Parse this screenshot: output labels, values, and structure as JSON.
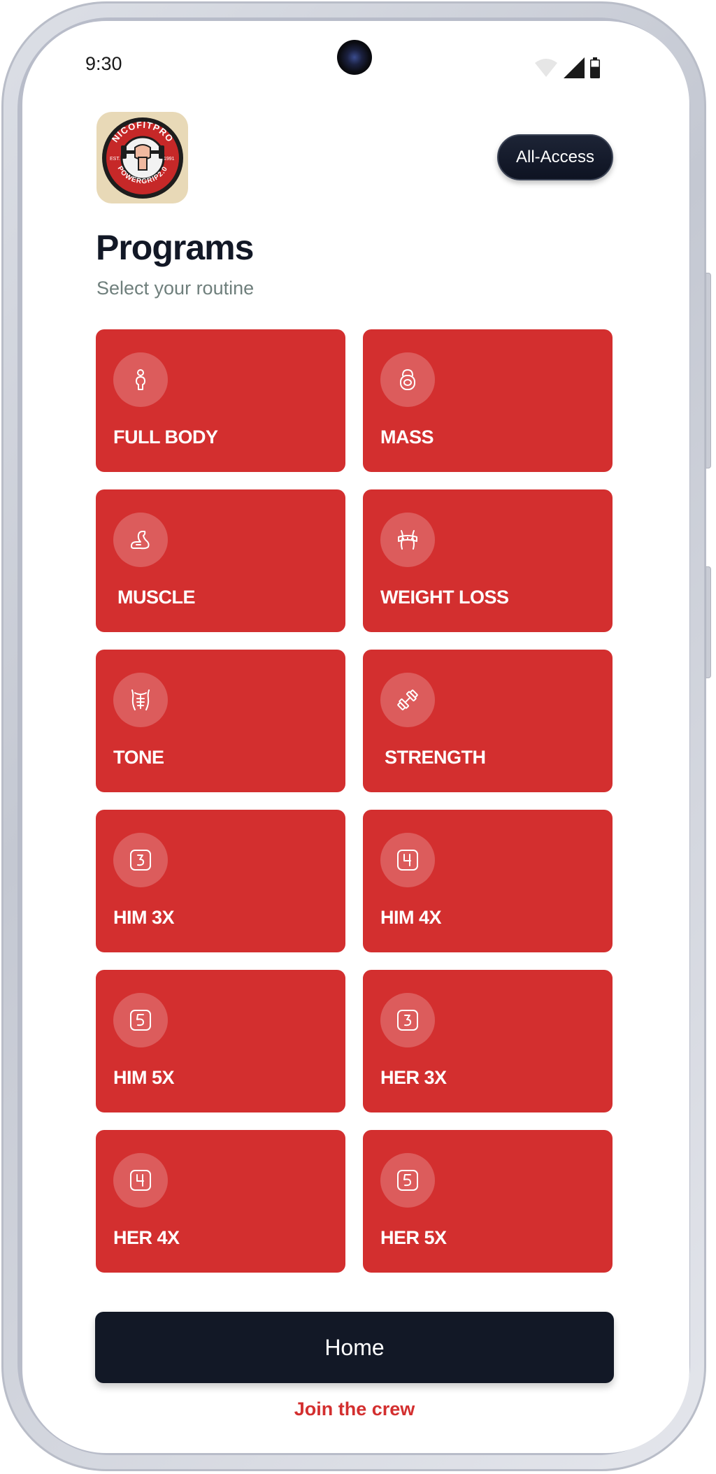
{
  "status_bar": {
    "time": "9:30"
  },
  "header": {
    "logo": {
      "text_top": "NICOFITPRO",
      "text_bottom": "POWERGRIP2.0",
      "est": "EST.",
      "year": "1991"
    },
    "all_access_label": "All-Access"
  },
  "page": {
    "title": "Programs",
    "subtitle": "Select your routine"
  },
  "programs": [
    {
      "label": "FULL BODY",
      "icon": "person-icon"
    },
    {
      "label": "MASS",
      "icon": "kettlebell-icon"
    },
    {
      "label": "MUSCLE",
      "icon": "flexed-bicep-icon"
    },
    {
      "label": "WEIGHT LOSS",
      "icon": "waist-measure-icon"
    },
    {
      "label": "TONE",
      "icon": "abs-torso-icon"
    },
    {
      "label": "STRENGTH",
      "icon": "dumbbell-icon"
    },
    {
      "label": "HIM 3X",
      "icon": "number-3-icon"
    },
    {
      "label": "HIM 4X",
      "icon": "number-4-icon"
    },
    {
      "label": "HIM 5X",
      "icon": "number-5-icon"
    },
    {
      "label": "HER 3X",
      "icon": "number-3-icon"
    },
    {
      "label": "HER 4X",
      "icon": "number-4-icon"
    },
    {
      "label": "HER 5X",
      "icon": "number-5-icon"
    }
  ],
  "footer": {
    "home_label": "Home",
    "join_label": "Join the crew"
  },
  "colors": {
    "card_red": "#d32f2f",
    "dark_navy": "#121826",
    "subtitle_gray": "#6f7f7c",
    "logo_beige": "#e8d9b7"
  }
}
